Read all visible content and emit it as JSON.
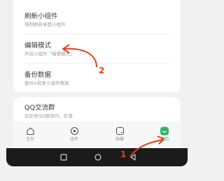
{
  "menu": {
    "items": [
      {
        "title": "刷新小组件",
        "subtitle": "强制刷新桌面小组件"
      },
      {
        "title": "编辑模式",
        "subtitle": "开启小组件「编辑模式」"
      },
      {
        "title": "备份数据",
        "subtitle": "备份&恢复小组件数据"
      }
    ],
    "qq_item": {
      "title": "QQ交流群",
      "subtitle": "欢迎进QQ群询问、反馈"
    }
  },
  "tabbar": {
    "tabs": [
      {
        "label": "主页"
      },
      {
        "label": "组件"
      },
      {
        "label": "收藏"
      },
      {
        "label": "我的"
      }
    ],
    "active_color": "#2db36b"
  },
  "annotations": {
    "step1": "1",
    "step2": "2",
    "color": "#e8401c"
  }
}
